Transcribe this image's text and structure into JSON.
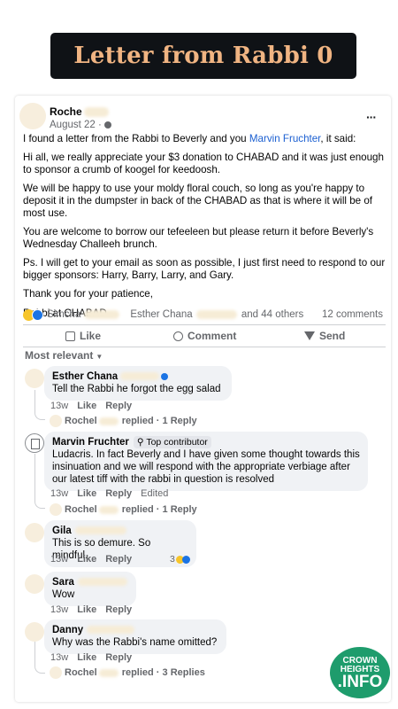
{
  "banner": {
    "title": "Letter from Rabbi 0"
  },
  "post": {
    "author": "Roche",
    "time": "August 22 ·",
    "intro_before": "I found a letter from the Rabbi to Beverly and you",
    "intro_mention": "Marvin Fruchter",
    "intro_after": ", it said:",
    "paragraphs": [
      "Hi all, we really appreciate your $3 donation to CHABAD and it was just enough to sponsor a crumb of koogel for keedoosh.",
      "We will be happy to use your moldy floral couch, so long as you're happy to deposit it in the dumpster in back of the CHABAD as that is where it will be of most use.",
      "You are welcome to borrow our tefeeleen but please return it before Beverly's Wednesday Challeeh brunch.",
      "Ps. I will get to your email as soon as possible, I just first need to respond to our bigger sponsors: Harry, Barry, Larry, and Gary.",
      "Thank you for your patience,"
    ],
    "signoff": "Rabbi at CHABAD",
    "reactions": {
      "name1": "Simcha",
      "name2": "Esther Chana",
      "others": "and 44 others",
      "comments": "12 comments"
    },
    "actions": {
      "like": "Like",
      "comment": "Comment",
      "send": "Send"
    }
  },
  "sort": {
    "label": "Most relevant"
  },
  "comments": [
    {
      "name": "Esther Chana",
      "text": "Tell the Rabbi he forgot the egg salad",
      "time": "13w",
      "like": "Like",
      "reply": "Reply",
      "replies": "Rochel",
      "replies_suffix": "replied · 1 Reply"
    },
    {
      "name": "Marvin Fruchter",
      "badge": "Top contributor",
      "text": "Ludacris. In fact Beverly and I have given some thought towards this insinuation and we will respond with the appropriate verbiage after our latest tiff with the rabbi in question is resolved",
      "time": "13w",
      "like": "Like",
      "reply": "Reply",
      "edited": "Edited",
      "replies": "Rochel",
      "replies_suffix": "replied · 1 Reply"
    },
    {
      "name": "Gila",
      "text": "This is so demure. So mindful.",
      "time": "13w",
      "like": "Like",
      "reply": "Reply",
      "reaction_count": "3"
    },
    {
      "name": "Sara",
      "text": "Wow",
      "time": "13w",
      "like": "Like",
      "reply": "Reply"
    },
    {
      "name": "Danny",
      "text": "Why was the Rabbi's name omitted?",
      "time": "13w",
      "like": "Like",
      "reply": "Reply",
      "replies": "Rochel",
      "replies_suffix": "replied · 3 Replies"
    }
  ],
  "watermark": {
    "line1": "CROWN",
    "line2": "HEIGHTS",
    "line3": ".INFO"
  },
  "colors": {
    "banner_bg": "#0f1216",
    "banner_text": "#f0b482",
    "mention": "#1b5fd1",
    "watermark": "#1e9c6c"
  }
}
